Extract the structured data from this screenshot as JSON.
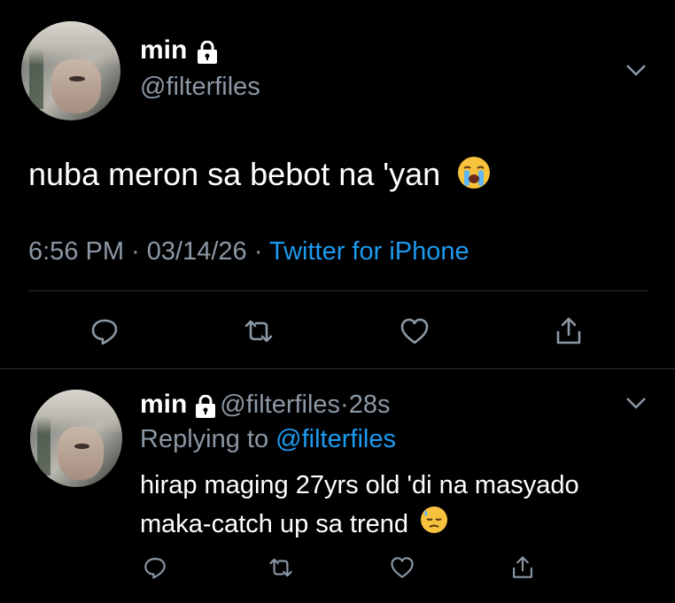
{
  "main_tweet": {
    "name": "min",
    "handle": "@filterfiles",
    "text": "nuba meron sa bebot na 'yan",
    "text_emoji": "loudly-crying-face",
    "time": "6:56 PM",
    "separator1": "·",
    "date": "03/14/26",
    "separator2": "·",
    "source": "Twitter for iPhone"
  },
  "reply_tweet": {
    "name": "min",
    "handle": "@filterfiles",
    "dot": "·",
    "age": "28s",
    "replying_label": "Replying to",
    "replying_handle": "@filterfiles",
    "line1": "hirap maging 27yrs old 'di na masyado",
    "line2": "maka-catch up sa trend",
    "text_emoji": "downcast-face-with-sweat"
  },
  "actions": [
    "reply-icon",
    "retweet-icon",
    "like-icon",
    "share-icon"
  ],
  "colors": {
    "background": "#000000",
    "secondary_text": "#8b98a5",
    "link": "#1d9bf0",
    "divider": "#2f3336"
  }
}
